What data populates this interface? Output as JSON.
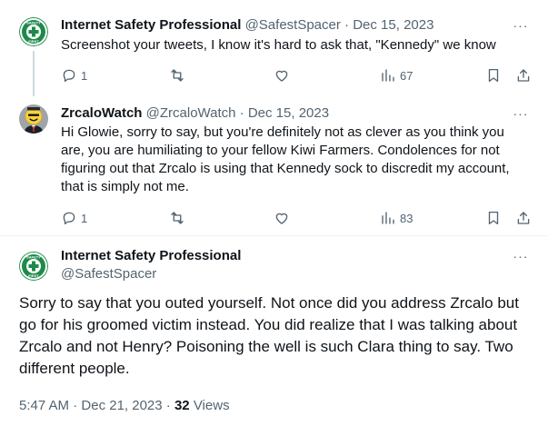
{
  "tweets": [
    {
      "name": "Internet Safety Professional",
      "handle": "@SafestSpacer",
      "separator": "·",
      "date": "Dec 15, 2023",
      "text": "Screenshot your tweets, I know it's hard to ask that, \"Kennedy\" we know",
      "replies": "1",
      "views": "67",
      "avatar_icon": "safety-first-badge-icon"
    },
    {
      "name": "ZrcaloWatch",
      "handle": "@ZrcaloWatch",
      "separator": "·",
      "date": "Dec 15, 2023",
      "text": "Hi Glowie, sorry to say, but you're definitely not as clever as you think you are, you are humiliating to your fellow Kiwi Farmers. Condolences for not figuring out that Zrcalo is using that Kennedy sock to discredit my account, that is simply not me.",
      "replies": "1",
      "views": "83",
      "avatar_icon": "smiley-suit-avatar-icon"
    }
  ],
  "main_tweet": {
    "name": "Internet Safety Professional",
    "handle": "@SafestSpacer",
    "text": "Sorry to say that you outed yourself. Not once did you address Zrcalo but go for his groomed victim instead. You did realize that I was talking about Zrcalo and not Henry? Poisoning the well is such Clara thing to say.  Two different people.",
    "time": "5:47 AM",
    "separator": "·",
    "date": "Dec 21, 2023",
    "views_count": "32",
    "views_label": "Views"
  },
  "more_label": "···",
  "colors": {
    "badge_green": "#1e8a4a",
    "text_primary": "#0f1419",
    "text_secondary": "#536471",
    "thread_line": "#cfd9de"
  }
}
